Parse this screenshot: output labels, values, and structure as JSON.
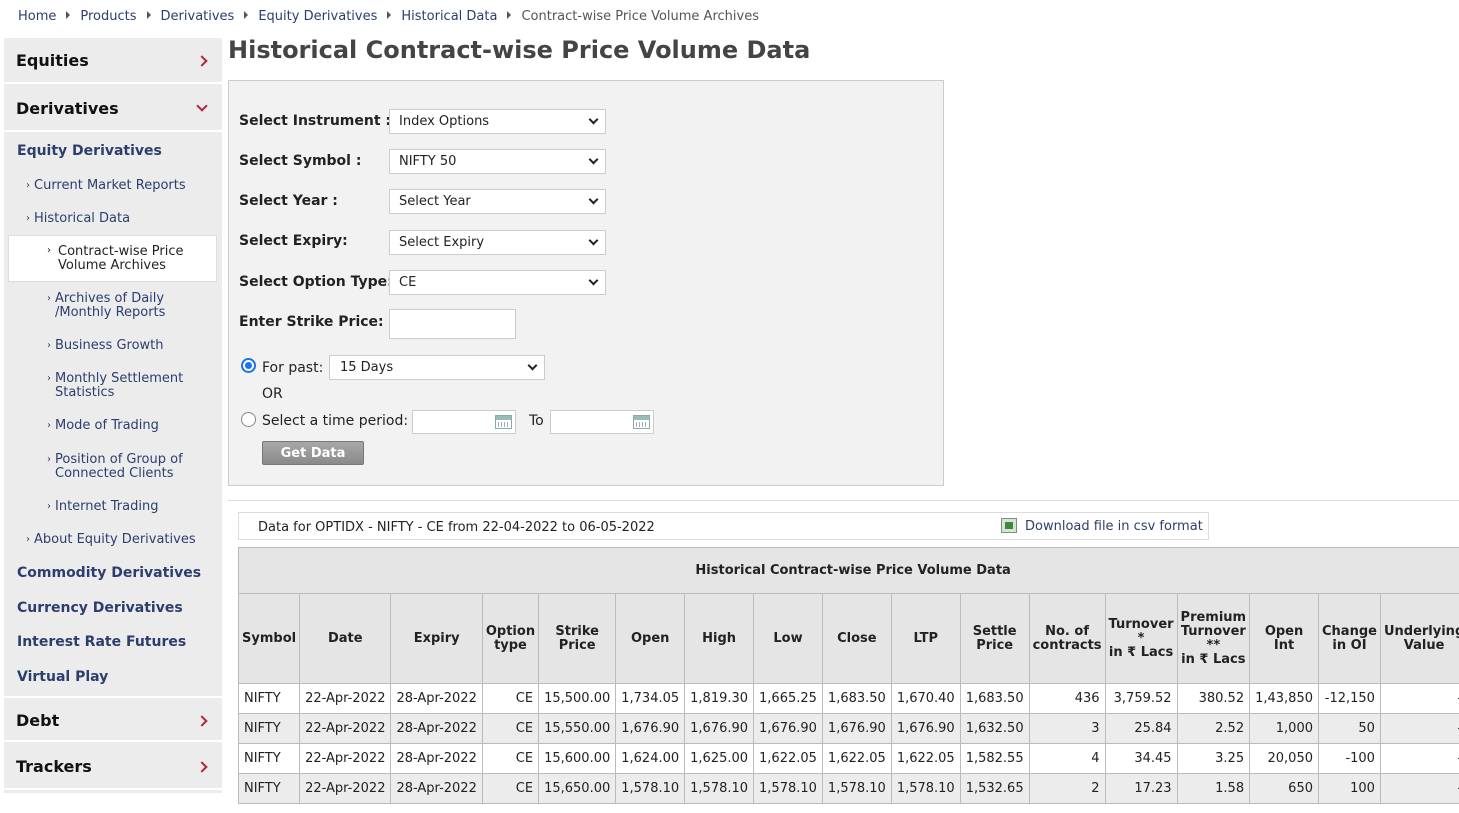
{
  "breadcrumb": [
    "Home",
    "Products",
    "Derivatives",
    "Equity Derivatives",
    "Historical Data",
    "Contract-wise Price Volume Archives"
  ],
  "sidebar": {
    "equities": "Equities",
    "derivatives": "Derivatives",
    "equity_derivatives": "Equity Derivatives",
    "current_market_reports": "Current Market Reports",
    "historical_data": "Historical Data",
    "contract_wise_1": "Contract-wise Price",
    "contract_wise_2": "Volume Archives",
    "archives_1": "Archives of Daily",
    "archives_2": "/Monthly Reports",
    "business_growth": "Business Growth",
    "monthly_1": "Monthly Settlement",
    "monthly_2": "Statistics",
    "mode_of_trading": "Mode of Trading",
    "position_1": "Position of Group of",
    "position_2": "Connected Clients",
    "internet_trading": "Internet Trading",
    "about": "About Equity Derivatives",
    "commodity": "Commodity Derivatives",
    "currency": "Currency Derivatives",
    "interest": "Interest Rate Futures",
    "virtual_play": "Virtual Play",
    "debt": "Debt",
    "trackers": "Trackers"
  },
  "page_title": "Historical Contract-wise Price Volume Data",
  "form": {
    "instrument_label": "Select Instrument :",
    "instrument_value": "Index Options",
    "symbol_label": "Select Symbol :",
    "symbol_value": "NIFTY 50",
    "year_label": "Select Year :",
    "year_value": "Select Year",
    "expiry_label": "Select Expiry:",
    "expiry_value": "Select Expiry",
    "option_type_label": "Select Option Type:",
    "option_type_value": "CE",
    "strike_label": "Enter Strike Price:",
    "for_past_label": "For past:",
    "for_past_value": "15 Days",
    "or_label": "OR",
    "time_period_label": "Select a time period:",
    "to_label": "To",
    "get_data": "Get Data"
  },
  "results": {
    "info_text": "Data for OPTIDX - NIFTY - CE from 22-04-2022 to 06-05-2022",
    "download_label": "Download file in csv format",
    "caption": "Historical Contract-wise Price Volume Data",
    "headers": {
      "symbol": "Symbol",
      "date": "Date",
      "expiry": "Expiry",
      "option_type_1": "Option",
      "option_type_2": "type",
      "strike_1": "Strike",
      "strike_2": "Price",
      "open": "Open",
      "high": "High",
      "low": "Low",
      "close": "Close",
      "ltp": "LTP",
      "settle_1": "Settle",
      "settle_2": "Price",
      "contracts_1": "No. of",
      "contracts_2": "contracts",
      "turnover_1": "Turnover *",
      "turnover_2": "in ₹ Lacs",
      "premium_1": "Premium",
      "premium_2": "Turnover",
      "premium_3": "**",
      "premium_4": "in ₹ Lacs",
      "open_int": "Open Int",
      "change_1": "Change",
      "change_2": "in OI",
      "underlying_1": "Underlying",
      "underlying_2": "Value"
    },
    "rows": [
      [
        "NIFTY",
        "22-Apr-2022",
        "28-Apr-2022",
        "CE",
        "15,500.00",
        "1,734.05",
        "1,819.30",
        "1,665.25",
        "1,683.50",
        "1,670.40",
        "1,683.50",
        "436",
        "3,759.52",
        "380.52",
        "1,43,850",
        "-12,150",
        "-"
      ],
      [
        "NIFTY",
        "22-Apr-2022",
        "28-Apr-2022",
        "CE",
        "15,550.00",
        "1,676.90",
        "1,676.90",
        "1,676.90",
        "1,676.90",
        "1,676.90",
        "1,632.50",
        "3",
        "25.84",
        "2.52",
        "1,000",
        "50",
        "-"
      ],
      [
        "NIFTY",
        "22-Apr-2022",
        "28-Apr-2022",
        "CE",
        "15,600.00",
        "1,624.00",
        "1,625.00",
        "1,622.05",
        "1,622.05",
        "1,622.05",
        "1,582.55",
        "4",
        "34.45",
        "3.25",
        "20,050",
        "-100",
        "-"
      ],
      [
        "NIFTY",
        "22-Apr-2022",
        "28-Apr-2022",
        "CE",
        "15,650.00",
        "1,578.10",
        "1,578.10",
        "1,578.10",
        "1,578.10",
        "1,578.10",
        "1,532.65",
        "2",
        "17.23",
        "1.58",
        "650",
        "100",
        "-"
      ]
    ]
  }
}
